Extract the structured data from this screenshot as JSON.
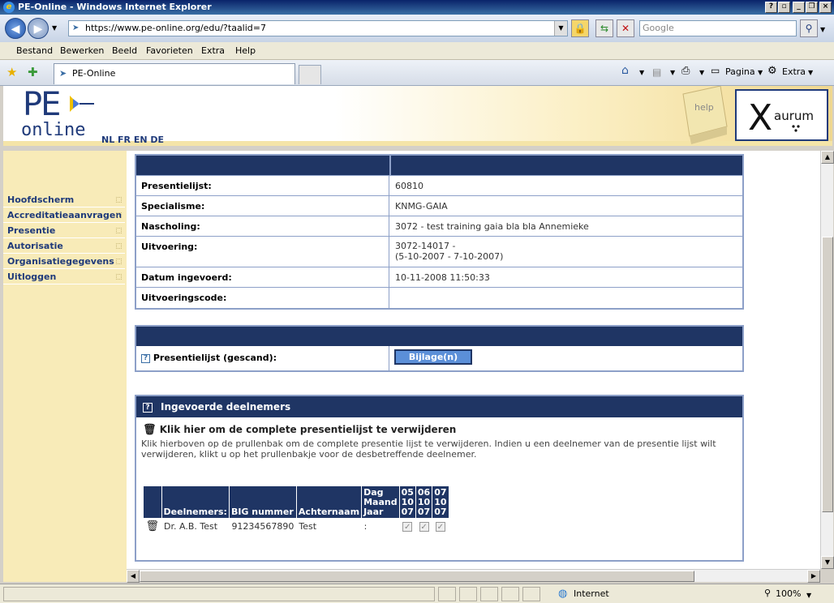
{
  "window": {
    "title": "PE-Online - Windows Internet Explorer"
  },
  "address": {
    "url": "https://www.pe-online.org/edu/?taalid=7",
    "search_placeholder": "Google"
  },
  "menu": [
    "Bestand",
    "Bewerken",
    "Beeld",
    "Favorieten",
    "Extra",
    "Help"
  ],
  "tab": {
    "title": "PE-Online"
  },
  "commandbar": {
    "page": "Pagina",
    "tools": "Extra"
  },
  "header": {
    "logo_pe": "PE",
    "logo_online": "online",
    "langs": "NL FR EN DE",
    "partner": "aurum",
    "help_word": "help"
  },
  "sidebar": {
    "items": [
      "Hoofdscherm",
      "Accreditatieaanvragen",
      "Presentie",
      "Autorisatie",
      "Organisatiegegevens",
      "Uitloggen"
    ]
  },
  "details": {
    "rows": [
      {
        "label": "Presentielijst:",
        "value": "60810"
      },
      {
        "label": "Specialisme:",
        "value": "KNMG-GAIA"
      },
      {
        "label": "Nascholing:",
        "value": "3072 - test training gaia bla bla Annemieke"
      },
      {
        "label": "Uitvoering:",
        "value": "3072-14017 -",
        "value2": "(5-10-2007 - 7-10-2007)"
      },
      {
        "label": "Datum ingevoerd:",
        "value": "10-11-2008 11:50:33"
      },
      {
        "label": "Uitvoeringscode:",
        "value": ""
      }
    ]
  },
  "scan": {
    "label": "Presentielijst (gescand):",
    "button": "Bijlage(n)"
  },
  "participants": {
    "title": "Ingevoerde deelnemers",
    "delete_all": "Klik hier om de complete presentielijst te verwijderen",
    "help_text": "Klik hierboven op de prullenbak om de complete presentie lijst te verwijderen. Indien u een deelnemer van de presentie lijst wilt verwijderen, klikt u op het prullenbakje voor de desbetreffende deelnemer.",
    "headers": {
      "name": "Deelnemers:",
      "big": "BIG nummer",
      "surname": "Achternaam",
      "dmy1": "Dag",
      "dmy2": "Maand",
      "dmy3": "Jaar"
    },
    "dates": [
      [
        "05",
        "10",
        "07"
      ],
      [
        "06",
        "10",
        "07"
      ],
      [
        "07",
        "10",
        "07"
      ]
    ],
    "rows": [
      {
        "name": "Dr. A.B. Test",
        "big": "91234567890",
        "surname": "Test",
        "dmy": ":"
      }
    ]
  },
  "status": {
    "zone": "Internet",
    "zoom": "100%"
  }
}
